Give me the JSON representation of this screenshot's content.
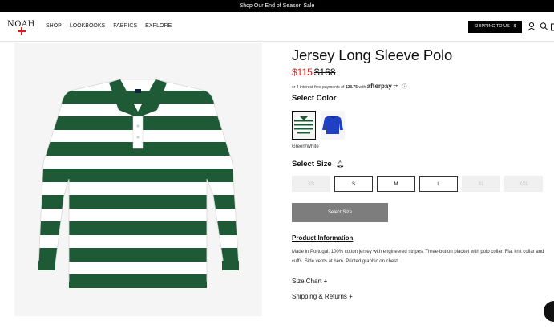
{
  "promo": {
    "text": "Shop Our End of Season Sale"
  },
  "header": {
    "logo_text": "NOAH",
    "menu": [
      "SHOP",
      "LOOKBOOKS",
      "FABRICS",
      "EXPLORE"
    ],
    "shipping_button": "SHIPPING TO US - $",
    "icons": [
      "user-icon",
      "search-icon",
      "cart-icon"
    ]
  },
  "product": {
    "title": "Jersey Long Sleeve Polo",
    "price_sale": "$115",
    "price_original": "$168",
    "afterpay_prefix": "or 4 interest-free payments of ",
    "afterpay_amount": "$28.75",
    "afterpay_with": " with ",
    "afterpay_brand": "afterpay",
    "select_color_label": "Select Color",
    "color_name": "Green/White",
    "select_size_label": "Select Size",
    "sizes": [
      {
        "label": "XS",
        "available": false
      },
      {
        "label": "S",
        "available": true
      },
      {
        "label": "M",
        "available": true
      },
      {
        "label": "L",
        "available": true
      },
      {
        "label": "XL",
        "available": false
      },
      {
        "label": "XXL",
        "available": false
      }
    ],
    "select_size_button": "Select Size",
    "info_heading": "Product Information",
    "info_text": "Made in Portugal. 100% cotton jersey with engineered stripes. Three-button placket with polo collar. Flat knit collar and cuffs. Side vents at hem. Printed graphic on chest.",
    "size_chart": "Size Chart +",
    "shipping_returns": "Shipping & Returns +"
  },
  "colors": {
    "green": "#1f5a36",
    "accent_red": "#e02020",
    "disabled": "#f0f0f0",
    "button_gray": "#7d7d7d"
  }
}
